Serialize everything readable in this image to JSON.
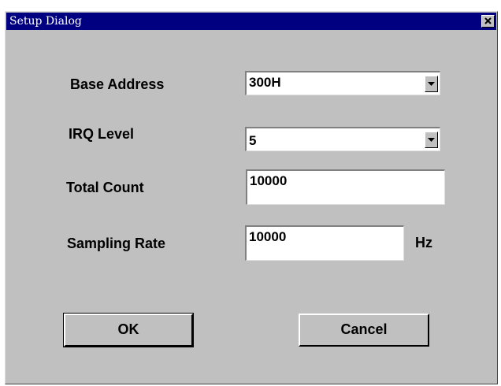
{
  "window": {
    "title": "Setup Dialog"
  },
  "form": {
    "base_address": {
      "label": "Base Address",
      "value": "300H"
    },
    "irq_level": {
      "label": "IRQ Level",
      "value": "5"
    },
    "total_count": {
      "label": "Total Count",
      "value": "10000"
    },
    "sampling_rate": {
      "label": "Sampling Rate",
      "value": "10000",
      "unit": "Hz"
    }
  },
  "buttons": {
    "ok": "OK",
    "cancel": "Cancel"
  },
  "icons": {
    "close": "close-icon",
    "dropdown": "chevron-down-icon"
  },
  "colors": {
    "titlebar": "#000080",
    "dialog_face": "#c0c0c0"
  }
}
